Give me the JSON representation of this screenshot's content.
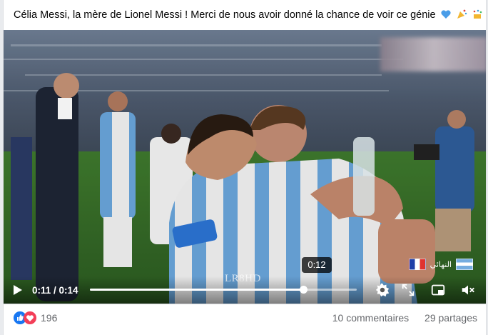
{
  "post": {
    "caption": "Célia Messi, la mère de Lionel Messi ! Merci de nous avoir donné la chance de voir ce génie",
    "caption_emojis": [
      "blue-heart",
      "party-popper",
      "confetti"
    ]
  },
  "video": {
    "current_time": "0:11",
    "duration": "0:14",
    "time_display": "0:11 / 0:14",
    "hover_time": "0:12",
    "progress_fraction": 0.8,
    "watermark": "LR8HD",
    "overlay_label": "النهائي",
    "overlay_flags": [
      "france-flag",
      "argentina-flag"
    ]
  },
  "footer": {
    "reaction_icons": [
      "like-icon",
      "love-icon"
    ],
    "reaction_count": "196",
    "comments": "10 commentaires",
    "shares": "29 partages"
  },
  "colors": {
    "accent": "#1877f2",
    "love": "#f33e58",
    "muted_text": "#65676b"
  }
}
